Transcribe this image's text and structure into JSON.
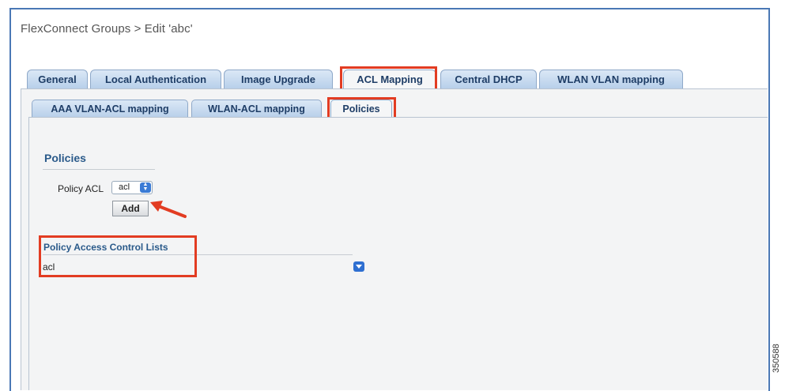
{
  "header": {
    "title": "FlexConnect Groups > Edit   'abc'"
  },
  "tabs": [
    {
      "label": "General"
    },
    {
      "label": "Local Authentication"
    },
    {
      "label": "Image Upgrade"
    },
    {
      "label": "ACL Mapping",
      "active": true
    },
    {
      "label": "Central DHCP"
    },
    {
      "label": "WLAN VLAN mapping"
    }
  ],
  "subtabs": [
    {
      "label": "AAA VLAN-ACL mapping"
    },
    {
      "label": "WLAN-ACL mapping"
    },
    {
      "label": "Policies",
      "active": true
    }
  ],
  "policies": {
    "title": "Policies",
    "policy_acl_label": "Policy ACL",
    "policy_acl_value": "acl",
    "add_button": "Add"
  },
  "policy_acls": {
    "title": "Policy Access Control Lists",
    "items": [
      "acl"
    ]
  },
  "figure_id": "350588",
  "colors": {
    "highlight": "#e23c22",
    "tab_fill": "#c8daf0",
    "heading": "#2a5a8a"
  },
  "icons": {
    "select_spinner": "spinner-icon",
    "row_dropdown": "dropdown-arrow-icon",
    "annotation": "arrow-icon"
  }
}
